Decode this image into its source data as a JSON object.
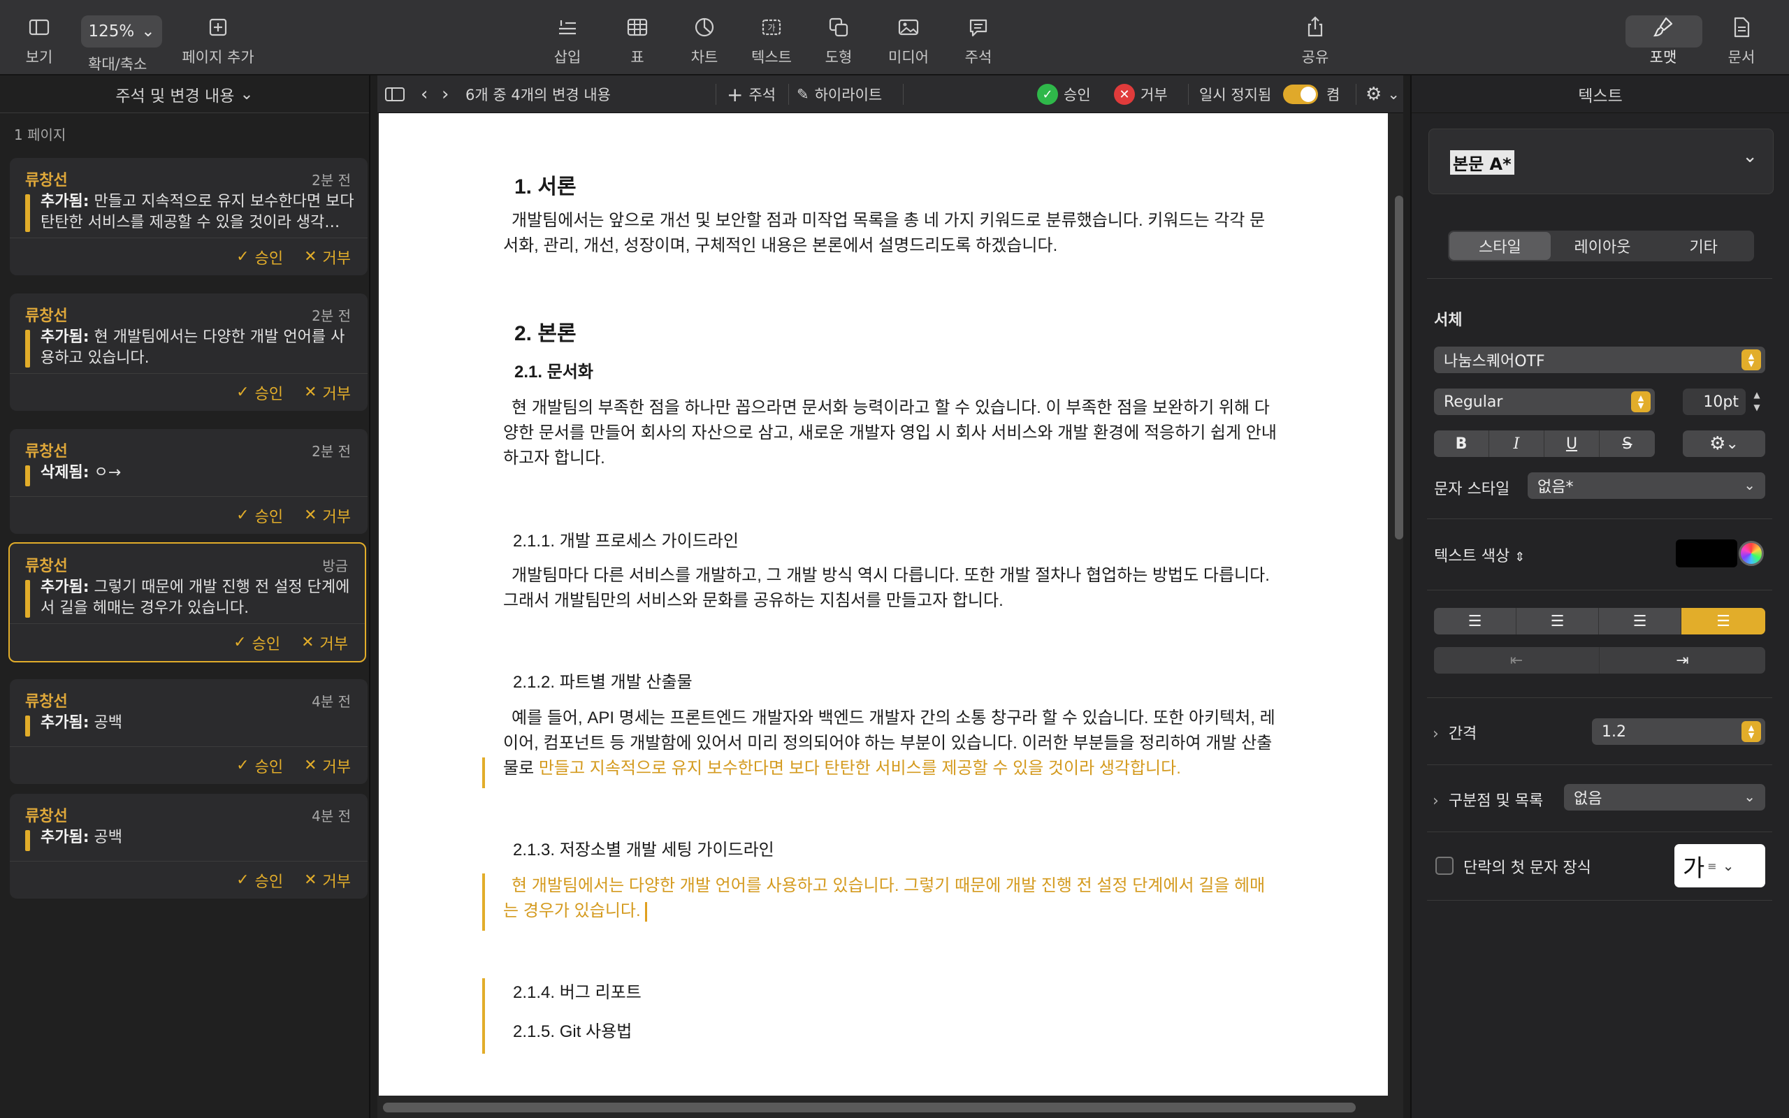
{
  "toolbar": {
    "view": "보기",
    "zoom_value": "125%",
    "zoom": "확대/축소",
    "add_page": "페이지 추가",
    "insert": "삽입",
    "table": "표",
    "chart": "차트",
    "text": "텍스트",
    "shape": "도형",
    "media": "미디어",
    "comment": "주석",
    "share": "공유",
    "format": "포맷",
    "document": "문서"
  },
  "left_panel": {
    "header": "주석 및 변경 내용",
    "page_label": "1 페이지",
    "accept": "승인",
    "reject": "거부",
    "cards": [
      {
        "author": "류창선",
        "time": "2분 전",
        "kind": "추가됨:",
        "text": "만들고 지속적으로 유지 보수한다면 보다 탄탄한 서비스를 제공할 수 있을 것이라 생각…"
      },
      {
        "author": "류창선",
        "time": "2분 전",
        "kind": "추가됨:",
        "text": "현 개발팀에서는 다양한 개발 언어를 사용하고 있습니다."
      },
      {
        "author": "류창선",
        "time": "2분 전",
        "kind": "삭제됨:",
        "text": "ㅇ→"
      },
      {
        "author": "류창선",
        "time": "방금",
        "kind": "추가됨:",
        "text": "그렇기 때문에 개발 진행 전 설정 단계에서 길을 헤매는 경우가 있습니다."
      },
      {
        "author": "류창선",
        "time": "4분 전",
        "kind": "추가됨:",
        "text": "공백"
      },
      {
        "author": "류창선",
        "time": "4분 전",
        "kind": "추가됨:",
        "text": "공백"
      }
    ]
  },
  "doc_toolbar": {
    "changes_count": "6개 중 4개의 변경 내용",
    "comment": "주석",
    "highlight": "하이라이트",
    "accept": "승인",
    "reject": "거부",
    "pause": "일시 정지됨",
    "on": "켬"
  },
  "document": {
    "h1_intro": "1. 서론",
    "intro_p": "개발팀에서는 앞으로 개선 및 보안할 점과 미작업 목록을 총 네 가지 키워드로 분류했습니다. 키워드는 각각 문서화, 관리, 개선, 성장이며, 구체적인 내용은 본론에서 설명드리도록 하겠습니다.",
    "h1_body": "2. 본론",
    "h2_docs": "2.1. 문서화",
    "docs_p": "현 개발팀의 부족한 점을 하나만 꼽으라면 문서화 능력이라고 할 수 있습니다. 이 부족한 점을 보완하기 위해 다양한 문서를 만들어 회사의 자산으로 삼고, 새로운 개발자 영입 시 회사 서비스와 개발 환경에 적응하기 쉽게 안내하고자 합니다.",
    "h3_process": "2.1.1. 개발 프로세스 가이드라인",
    "process_p": "개발팀마다 다른 서비스를 개발하고, 그 개발 방식 역시 다릅니다. 또한 개발 절차나 협업하는 방법도 다릅니다. 그래서 개발팀만의 서비스와 문화를 공유하는 지침서를 만들고자 합니다.",
    "h3_output": "2.1.2. 파트별 개발 산출물",
    "output_p": "예를 들어, API 명세는 프론트엔드 개발자와 백엔드 개발자 간의 소통 창구라 할 수 있습니다. 또한 아키텍처, 레이어, 컴포넌트 등 개발함에 있어서 미리 정의되어야 하는 부분이 있습니다. 이러한 부분들을 정리하여 개발 산출물로 ",
    "output_ins": "만들고 지속적으로 유지 보수한다면 보다 탄탄한 서비스를 제공할 수 있을 것이라 생각합니다.",
    "h3_repo": "2.1.3. 저장소별 개발 세팅 가이드라인",
    "repo_ins": "현 개발팀에서는 다양한 개발 언어를 사용하고 있습니다. 그렇기 때문에 개발 진행 전 설정 단계에서 길을 헤매는 경우가 있습니다.",
    "h3_bug": "2.1.4. 버그 리포트",
    "h3_git": "2.1.5. Git 사용법"
  },
  "right_panel": {
    "title": "텍스트",
    "style_name": "본문 A*",
    "tabs": [
      "스타일",
      "레이아웃",
      "기타"
    ],
    "font_label": "서체",
    "font": "나눔스퀘어OTF",
    "weight": "Regular",
    "size": "10pt",
    "bold": "B",
    "italic": "I",
    "underline": "U",
    "strike": "S",
    "char_style_label": "문자 스타일",
    "char_style": "없음*",
    "text_color_label": "텍스트 색상",
    "spacing_label": "간격",
    "spacing": "1.2",
    "bullets_label": "구분점 및 목록",
    "bullets": "없음",
    "dropcap_label": "단락의 첫 문자 장식",
    "dropcap_char": "가"
  },
  "colors": {
    "accent": "#e2ad2a",
    "insertion": "#d49a1e",
    "accept_green": "#2fb84a",
    "reject_red": "#e03b3b"
  }
}
